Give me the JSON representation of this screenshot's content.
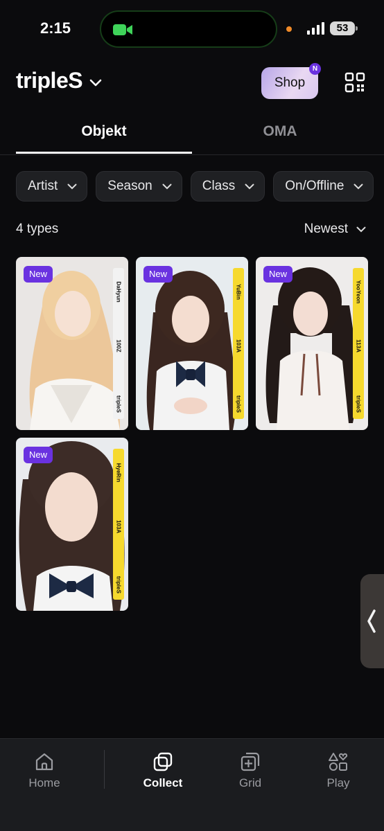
{
  "status_bar": {
    "time": "2:15",
    "battery": "53"
  },
  "header": {
    "brand": "tripleS",
    "shop_label": "Shop",
    "shop_badge": "N"
  },
  "tabs": [
    {
      "label": "Objekt",
      "active": true
    },
    {
      "label": "OMA",
      "active": false
    }
  ],
  "filters": [
    "Artist",
    "Season",
    "Class",
    "On/Offline"
  ],
  "list": {
    "count_label": "4 types",
    "sort_label": "Newest"
  },
  "cards": [
    {
      "badge": "New",
      "member": "DaHyun",
      "code": "100Z",
      "group": "tripleS",
      "strip_color": "#f2f2f2"
    },
    {
      "badge": "New",
      "member": "YuBin",
      "code": "103A",
      "group": "tripleS",
      "strip_color": "#f6d92e"
    },
    {
      "badge": "New",
      "member": "YooYeon",
      "code": "113A",
      "group": "tripleS",
      "strip_color": "#f6d92e"
    },
    {
      "badge": "New",
      "member": "HyeRin",
      "code": "103A",
      "group": "tripleS",
      "strip_color": "#f6d92e"
    }
  ],
  "bottom_nav": [
    {
      "label": "Home",
      "icon": "home-icon",
      "active": false
    },
    {
      "label": "Collect",
      "icon": "collect-icon",
      "active": true
    },
    {
      "label": "Grid",
      "icon": "grid-icon",
      "active": false
    },
    {
      "label": "Play",
      "icon": "play-icon",
      "active": false
    }
  ],
  "colors": {
    "accent": "#6a32e0",
    "background": "#0b0b0d",
    "strip_yellow": "#f6d92e"
  }
}
